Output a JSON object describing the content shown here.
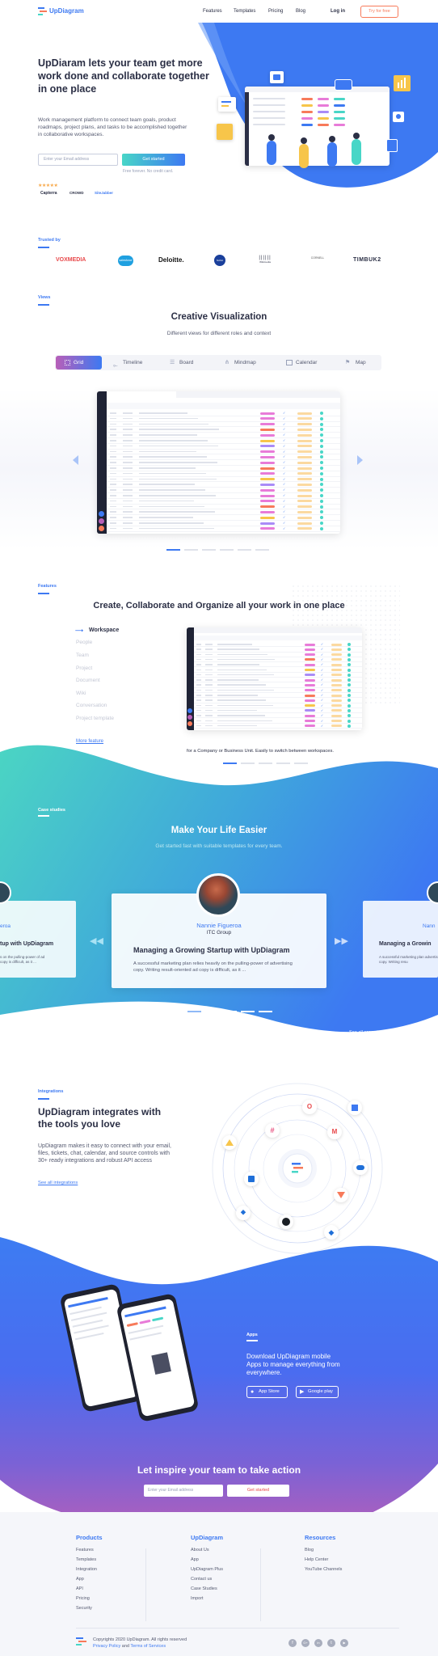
{
  "nav": {
    "brand": "UpDiagram",
    "links": [
      "Features",
      "Templates",
      "Pricing",
      "Blog"
    ],
    "login": "Log in",
    "try": "Try for free"
  },
  "hero": {
    "title": "UpDiaram lets your team get more work done and collaborate together in one place",
    "desc": "Work management platform to connect team goals, product roadmaps, project plans, and tasks to be accomplished together in collaborative workspaces.",
    "email_placeholder": "Enter your Email address",
    "cta": "Get started",
    "note": "Free forever. No credit card.",
    "stars": "★★★★★",
    "reviews": [
      "Capterra",
      "CROWD",
      "SiteJabber"
    ]
  },
  "trusted": {
    "label": "Trusted by",
    "logos": [
      "VOXMEDIA",
      "salesforce",
      "Deloitte.",
      "NASA",
      "Wikimedia",
      "CORNELL",
      "TIMBUK2"
    ]
  },
  "views": {
    "label": "Views",
    "title": "Creative Visualization",
    "subtitle": "Different views for different roles and context",
    "tabs": [
      "Grid",
      "Timeline",
      "Board",
      "Mindmap",
      "Calendar",
      "Map"
    ]
  },
  "features": {
    "label": "Features",
    "title": "Create, Collaborate and Organize all your work in one place",
    "items": [
      "Workspace",
      "People",
      "Team",
      "Project",
      "Document",
      "Wiki",
      "Conversation",
      "Project template"
    ],
    "more": "More feature",
    "caption": "for a Company or Business Unit. Easily to switch between workspaces."
  },
  "cases": {
    "label": "Case studies",
    "title": "Make Your Life Easier",
    "subtitle": "Get started fast with suitable templates for every team.",
    "card": {
      "name": "Nannie Figueroa",
      "company": "ITC Group",
      "heading": "Managing a Growing Startup with UpDiagram",
      "text": "A successful marketing plan relies heavily on the pulling-power of advertising copy. Writing result-oriented ad copy is difficult, as it ..."
    },
    "left": {
      "name": "eroa",
      "heading": "tup with UpDiagram",
      "text": "s on the pulling-power of ad copy is difficult, as it ..."
    },
    "right": {
      "name": "Nann",
      "heading": "Managing a Growin",
      "text": "A successful marketing plan advertising copy. Writing resu"
    },
    "see_all": "See all case studies"
  },
  "integrations": {
    "label": "Integrations",
    "title": "UpDiagram integrates with the tools you love",
    "desc": "UpDiagram makes it easy to connect with your email, files, tickets, chat, calendar, and source controls with 30+ ready integrations and robust API access",
    "link": "See all integrations"
  },
  "apps": {
    "label": "Apps",
    "desc": "Download UpDiagram mobile Apps to manage everything from everywhere.",
    "appstore": "App Store",
    "gplay": "Google play"
  },
  "inspire": {
    "title": "Let inspire your team to take action",
    "placeholder": "Enter your Email address",
    "cta": "Get started"
  },
  "footer": {
    "cols": [
      {
        "title": "Products",
        "items": [
          "Features",
          "Templates",
          "Integration",
          "App",
          "API",
          "Pricing",
          "Security"
        ]
      },
      {
        "title": "UpDiagram",
        "items": [
          "About Us",
          "App",
          "UpDiagram Plus",
          "Contact us",
          "Case Studies",
          "Import"
        ]
      },
      {
        "title": "Resources",
        "items": [
          "Blog",
          "Help Center",
          "YouTube Channels"
        ]
      }
    ],
    "copyright": "Copyrights 2020 UpDiagram. All rights reserved",
    "legal_pre": "Privacy Policy",
    "legal_and": " and ",
    "legal_post": "Terms of Services",
    "social": [
      "f",
      "G+",
      "in",
      "t",
      "▶"
    ]
  },
  "colors": {
    "blue": "#3d79f2",
    "teal": "#48d6c7",
    "orange": "#f77a5a",
    "purple": "#b85fb8",
    "navy": "#2b2f45"
  }
}
